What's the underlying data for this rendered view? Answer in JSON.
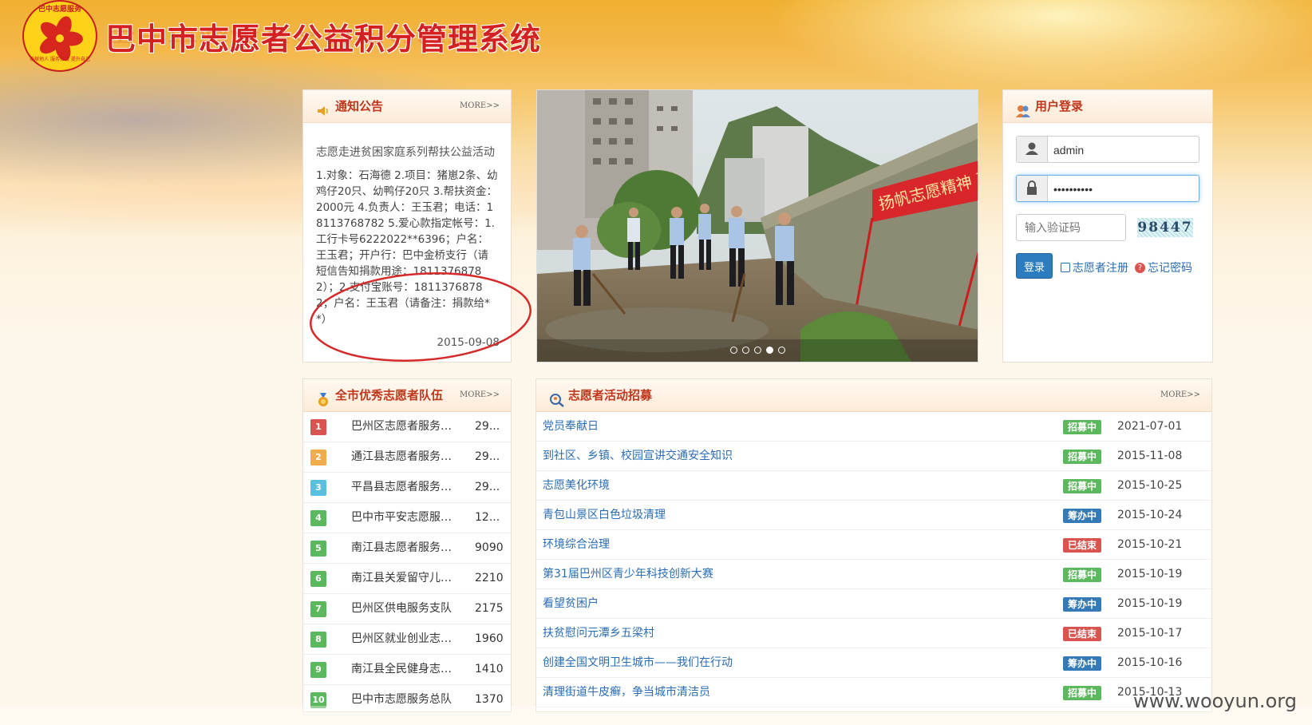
{
  "header": {
    "title": "巴中市志愿者公益积分管理系统",
    "logo_text_top": "巴中志愿服务",
    "logo_text_bottom": "奉献他人 服务社会 提升自己"
  },
  "notice": {
    "heading": "通知公告",
    "more": "MORE>>",
    "title": "志愿走进贫困家庭系列帮扶公益活动",
    "body": "1.对象：石海德 2.项目：猪崽2条、幼鸡仔20只、幼鸭仔20只 3.帮扶资金：2000元 4.负责人：王玉君；电话：18113768782 5.爱心款指定帐号：1.工行卡号6222022**6396；户名：王玉君；开户行：巴中金桥支行（请短信告知捐款用途：18113768782）；2.支付宝账号：18113768782；户名：王玉君（请备注：捐款给**）",
    "date": "2015-09-08"
  },
  "slider": {
    "banner_text": "扬帆志愿精神 建设美好",
    "dot_count": 5,
    "active_dot": 4
  },
  "login": {
    "heading": "用户登录",
    "username": "admin",
    "password": "••••••••••",
    "captcha_placeholder": "输入验证码",
    "captcha_code": "98447",
    "submit_label": "登录",
    "register_label": "志愿者注册",
    "forgot_label": "忘记密码"
  },
  "teams": {
    "heading": "全市优秀志愿者队伍",
    "more": "MORE>>",
    "items": [
      {
        "rank": "1",
        "name": "巴州区志愿者服务支队",
        "score": "29...",
        "color": "#d9534f"
      },
      {
        "rank": "2",
        "name": "通江县志愿者服务支队",
        "score": "29...",
        "color": "#f0ad4e"
      },
      {
        "rank": "3",
        "name": "平昌县志愿者服务支队",
        "score": "29...",
        "color": "#5bc0de"
      },
      {
        "rank": "4",
        "name": "巴中市平安志愿服务支队",
        "score": "12...",
        "color": "#5cb85c"
      },
      {
        "rank": "5",
        "name": "南江县志愿者服务支队",
        "score": "9090",
        "color": "#5cb85c"
      },
      {
        "rank": "6",
        "name": "南江县关爱留守儿童志愿者",
        "score": "2210",
        "color": "#5cb85c"
      },
      {
        "rank": "7",
        "name": "巴州区供电服务支队",
        "score": "2175",
        "color": "#5cb85c"
      },
      {
        "rank": "8",
        "name": "巴州区就业创业志愿者",
        "score": "1960",
        "color": "#5cb85c"
      },
      {
        "rank": "9",
        "name": "南江县全民健身志愿者",
        "score": "1410",
        "color": "#5cb85c"
      },
      {
        "rank": "10",
        "name": "巴中市志愿服务总队",
        "score": "1370",
        "color": "#5cb85c"
      }
    ]
  },
  "recruit": {
    "heading": "志愿者活动招募",
    "more": "MORE>>",
    "status_colors": {
      "招募中": "#5cb85c",
      "筹办中": "#337ab7",
      "已结束": "#d9534f"
    },
    "items": [
      {
        "title": "党员奉献日",
        "status": "招募中",
        "date": "2021-07-01"
      },
      {
        "title": "到社区、乡镇、校园宣讲交通安全知识",
        "status": "招募中",
        "date": "2015-11-08"
      },
      {
        "title": "志愿美化环境",
        "status": "招募中",
        "date": "2015-10-25"
      },
      {
        "title": "青包山景区白色垃圾清理",
        "status": "筹办中",
        "date": "2015-10-24"
      },
      {
        "title": "环境综合治理",
        "status": "已结束",
        "date": "2015-10-21"
      },
      {
        "title": "第31届巴州区青少年科技创新大赛",
        "status": "招募中",
        "date": "2015-10-19"
      },
      {
        "title": "看望贫困户",
        "status": "筹办中",
        "date": "2015-10-19"
      },
      {
        "title": "扶贫慰问元潭乡五梁村",
        "status": "已结束",
        "date": "2015-10-17"
      },
      {
        "title": "创建全国文明卫生城市——我们在行动",
        "status": "筹办中",
        "date": "2015-10-16"
      },
      {
        "title": "清理街道牛皮癣，争当城市清洁员",
        "status": "招募中",
        "date": "2015-10-13"
      }
    ]
  },
  "watermark": "www.wooyun.org"
}
